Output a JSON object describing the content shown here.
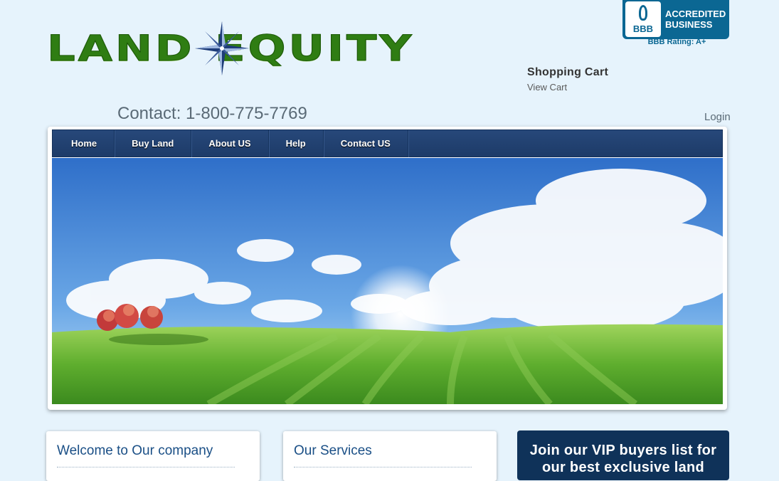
{
  "logo": {
    "word1": "LAND",
    "word2": "EQUITY"
  },
  "bbb": {
    "seal": "BBB",
    "line1": "ACCREDITED",
    "line2": "BUSINESS",
    "rating": "BBB Rating: A+"
  },
  "cart": {
    "title": "Shopping Cart",
    "link": "View Cart"
  },
  "contact": "Contact: 1-800-775-7769",
  "login": "Login",
  "nav": {
    "items": [
      "Home",
      "Buy Land",
      "About US",
      "Help",
      "Contact US"
    ]
  },
  "boxes": {
    "welcome_title": "Welcome to Our company",
    "services_title": "Our Services"
  },
  "vip": {
    "line1": "Join our VIP buyers list for",
    "line2": "our best exclusive land"
  },
  "colors": {
    "background": "#e6f3fc",
    "brand_green": "#2f7d13",
    "nav_blue": "#1d3b68",
    "title_blue": "#1a4f86"
  }
}
